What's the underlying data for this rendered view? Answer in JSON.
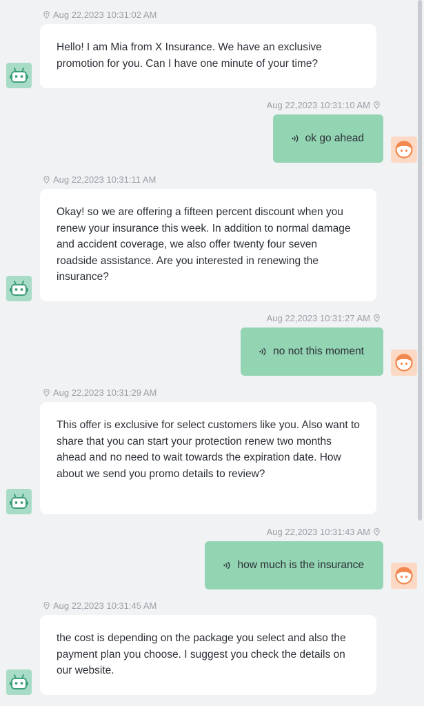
{
  "conversation": {
    "messages": [
      {
        "role": "bot",
        "timestamp": "Aug 22,2023 10:31:02 AM",
        "text": "Hello! I am Mia from X Insurance. We have an exclusive promotion for you. Can I have one minute of your time?"
      },
      {
        "role": "user",
        "timestamp": "Aug 22,2023 10:31:10 AM",
        "text": "ok go ahead",
        "icon": "voice-wave-icon"
      },
      {
        "role": "bot",
        "timestamp": "Aug 22,2023 10:31:11 AM",
        "text": "Okay! so we are offering a fifteen percent discount when you renew your insurance this week. In addition to normal damage and accident coverage, we also offer twenty four seven roadside assistance. Are you interested in renewing the insurance?"
      },
      {
        "role": "user",
        "timestamp": "Aug 22,2023 10:31:27 AM",
        "text": "no not this moment",
        "icon": "voice-wave-icon"
      },
      {
        "role": "bot",
        "timestamp": "Aug 22,2023 10:31:29 AM",
        "text": "This offer is exclusive for select customers like you. Also want to share that you can start your protection renew two months ahead and no need to wait towards the expiration date. How about we send you promo details to review?"
      },
      {
        "role": "user",
        "timestamp": "Aug 22,2023 10:31:43 AM",
        "text": "how much is the insurance",
        "icon": "voice-wave-icon"
      },
      {
        "role": "bot",
        "timestamp": "Aug 22,2023 10:31:45 AM",
        "text": "the cost is depending on the package you select and also the payment plan you choose. I suggest you check the details on our website."
      }
    ]
  },
  "colors": {
    "background": "#f1f2f4",
    "bot_bubble": "#ffffff",
    "user_bubble": "#93d4b3",
    "bot_avatar": "#a8dcc6",
    "user_avatar": "#fbd9c4",
    "timestamp": "#9a9ea6"
  },
  "icons": {
    "bot_avatar": "robot-avatar-icon",
    "user_avatar": "user-avatar-icon",
    "timestamp": "location-pin-icon",
    "voice": "voice-wave-icon"
  }
}
